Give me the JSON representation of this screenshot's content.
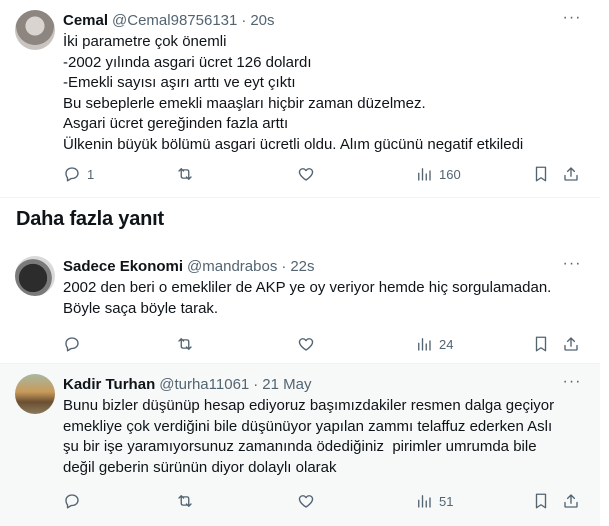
{
  "tweets": [
    {
      "name": "Cemal",
      "handle": "@Cemal98756131",
      "separator": "·",
      "time": "20s",
      "text": "İki parametre çok önemli\n-2002 yılında asgari ücret 126 dolardı\n-Emekli sayısı aşırı arttı ve eyt çıktı\nBu sebeplerle emekli maaşları hiçbir zaman düzelmez.\nAsgari ücret gereğinden fazla arttı\nÜlkenin büyük bölümü asgari ücretli oldu. Alım gücünü negatif etkiledi",
      "replies": "1",
      "retweets": "",
      "likes": "",
      "views": "160"
    },
    {
      "name": "Sadece Ekonomi",
      "handle": "@mandrabos",
      "separator": "·",
      "time": "22s",
      "text": "2002 den beri o emekliler de AKP ye oy veriyor hemde hiç sorgulamadan.\nBöyle saça böyle tarak.",
      "replies": "",
      "retweets": "",
      "likes": "",
      "views": "24"
    },
    {
      "name": "Kadir Turhan",
      "handle": "@turha11061",
      "separator": "·",
      "time": "21 May",
      "text": "Bunu bizler düşünüp hesap ediyoruz başımızdakiler resmen dalga geçiyor\nemekliye çok verdiğini bile düşünüyor yapılan zammı telaffuz ederken Aslı\nşu bir işe yaramıyorsunuz zamanında ödediğiniz  pirimler umrumda bile\ndeğil geberin sürünün diyor dolaylı olarak",
      "replies": "",
      "retweets": "",
      "likes": "",
      "views": "51"
    }
  ],
  "section_title": "Daha fazla yanıt",
  "more_glyph": "···",
  "icons": {
    "reply": "reply-icon",
    "retweet": "retweet-icon",
    "like": "heart-icon",
    "views": "views-icon",
    "bookmark": "bookmark-icon",
    "share": "share-icon"
  },
  "colors": {
    "text": "#0f1419",
    "secondary": "#536471",
    "hover_bg": "#f7f9f9",
    "divider": "#eff3f4"
  }
}
